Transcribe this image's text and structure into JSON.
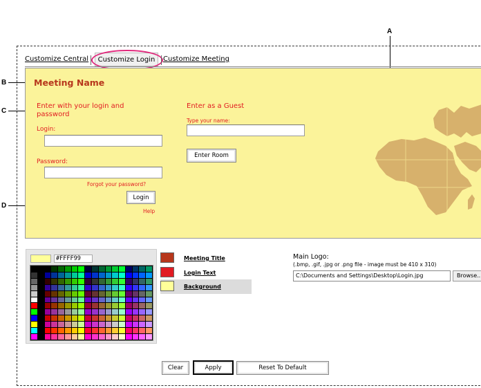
{
  "callouts": {
    "a": "A",
    "b": "B",
    "c": "C",
    "d": "D"
  },
  "tabs": {
    "central": "Customize Central",
    "login": "Customize Login",
    "meeting": "Customize Meeting"
  },
  "login_panel": {
    "meeting_name": "Meeting Name",
    "member_heading": "Enter with your login and password",
    "login_label": "Login:",
    "password_label": "Password:",
    "forgot_link": "Forgot your password?",
    "login_button": "Login",
    "help_link": "Help",
    "guest_heading": "Enter as a Guest",
    "guest_name_label": "Type your name:",
    "enter_room_button": "Enter Room"
  },
  "color_picker": {
    "hex_value": "#FFFF99",
    "preview_color": "#FFFF99"
  },
  "color_targets": [
    {
      "label": "Meeting Title",
      "color": "#b7371c"
    },
    {
      "label": "Login Text",
      "color": "#e11b22"
    },
    {
      "label": "Background",
      "color": "#ffff99"
    }
  ],
  "logo": {
    "label": "Main Logo:",
    "hint": "(.bmp, .gif, .jpg or .png file - image must be 410 x 310)",
    "path": "C:\\Documents and Settings\\Desktop\\Login.jpg",
    "browse_button": "Browse..."
  },
  "actions": {
    "clear": "Clear",
    "apply": "Apply",
    "reset": "Reset To Default"
  },
  "colors": {
    "panel_bg": "#fbf39a",
    "accent_red": "#e11b22",
    "title_brown": "#b7371c",
    "tab_highlight": "#e0287c",
    "map": "#d7b16c"
  }
}
